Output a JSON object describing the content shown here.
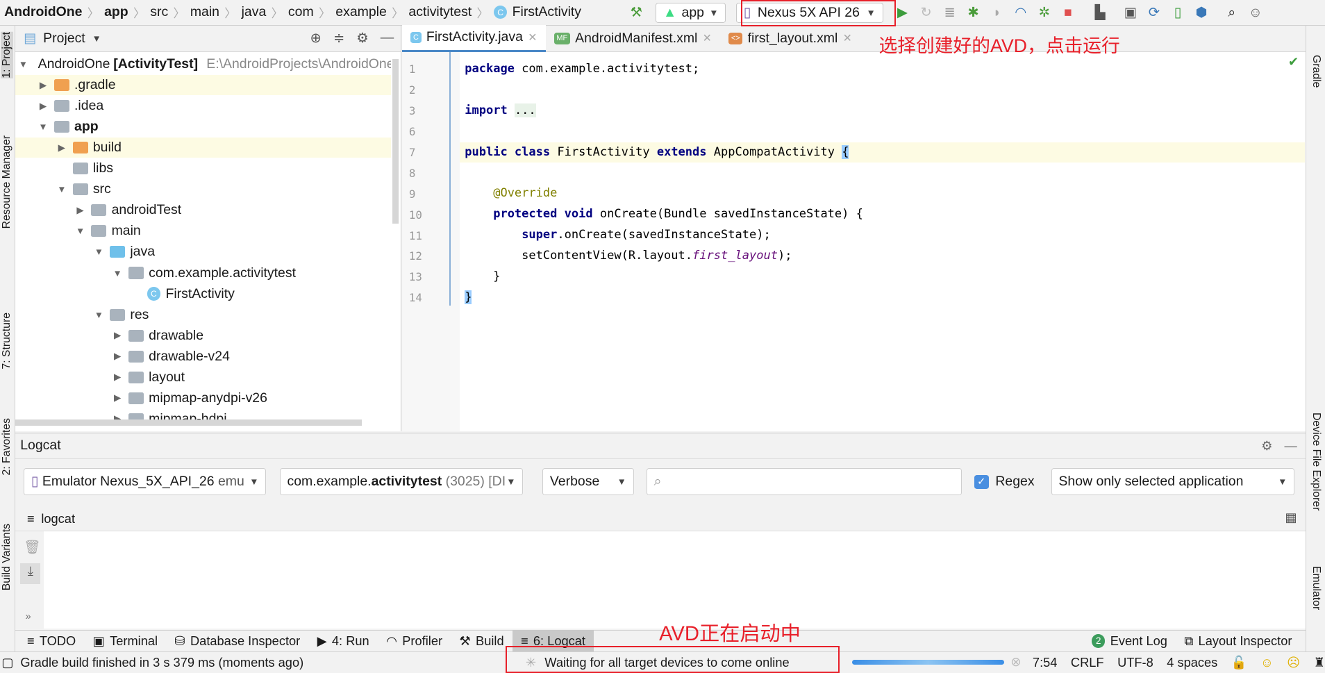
{
  "breadcrumbs": [
    "AndroidOne",
    "app",
    "src",
    "main",
    "java",
    "com",
    "example",
    "activitytest",
    "FirstActivity"
  ],
  "toolbar": {
    "run_config": "app",
    "device": "Nexus 5X API 26",
    "icons": [
      "hammer-icon",
      "run-icon",
      "rerun-icon",
      "apply-changes-icon",
      "debug-icon",
      "attach-icon",
      "profile-icon",
      "debug-attach-icon",
      "stop-icon",
      "sync-icon",
      "terminal-icon",
      "avd-manager-icon",
      "device-icon",
      "sdk-icon",
      "search-icon",
      "account-icon"
    ]
  },
  "left_strip": [
    "1: Project",
    "Resource Manager",
    "7: Structure",
    "2: Favorites",
    "Build Variants"
  ],
  "right_strip": [
    "Gradle",
    "Device File Explorer",
    "Emulator"
  ],
  "project": {
    "title": "Project",
    "tree": [
      {
        "label": "AndroidOne",
        "bold": "[ActivityTest]",
        "path": "E:\\AndroidProjects\\AndroidOne",
        "depth": 0,
        "open": true,
        "hl": false,
        "icon": "gray"
      },
      {
        "label": ".gradle",
        "depth": 1,
        "open": false,
        "hl": true,
        "icon": "orange"
      },
      {
        "label": ".idea",
        "depth": 1,
        "open": false,
        "hl": false,
        "icon": "gray"
      },
      {
        "label": "app",
        "depth": 1,
        "open": true,
        "hl": false,
        "icon": "gray",
        "boldrow": true
      },
      {
        "label": "build",
        "depth": 2,
        "open": false,
        "hl": true,
        "icon": "orange"
      },
      {
        "label": "libs",
        "depth": 2,
        "leaf": true,
        "hl": false,
        "icon": "gray"
      },
      {
        "label": "src",
        "depth": 2,
        "open": true,
        "hl": false,
        "icon": "gray"
      },
      {
        "label": "androidTest",
        "depth": 3,
        "open": false,
        "hl": false,
        "icon": "gray"
      },
      {
        "label": "main",
        "depth": 3,
        "open": true,
        "hl": false,
        "icon": "gray"
      },
      {
        "label": "java",
        "depth": 4,
        "open": true,
        "hl": false,
        "icon": "blue"
      },
      {
        "label": "com.example.activitytest",
        "depth": 5,
        "open": true,
        "hl": false,
        "icon": "gray"
      },
      {
        "label": "FirstActivity",
        "depth": 6,
        "leaf": true,
        "hl": false,
        "icon": "class"
      },
      {
        "label": "res",
        "depth": 4,
        "open": true,
        "hl": false,
        "icon": "gray"
      },
      {
        "label": "drawable",
        "depth": 5,
        "open": false,
        "hl": false,
        "icon": "gray"
      },
      {
        "label": "drawable-v24",
        "depth": 5,
        "open": false,
        "hl": false,
        "icon": "gray"
      },
      {
        "label": "layout",
        "depth": 5,
        "open": false,
        "hl": false,
        "icon": "gray"
      },
      {
        "label": "mipmap-anydpi-v26",
        "depth": 5,
        "open": false,
        "hl": false,
        "icon": "gray"
      },
      {
        "label": "mipmap-hdpi",
        "depth": 5,
        "open": false,
        "hl": false,
        "icon": "gray"
      }
    ]
  },
  "editor": {
    "tabs": [
      {
        "label": "FirstActivity.java",
        "active": true,
        "icon": "C"
      },
      {
        "label": "AndroidManifest.xml",
        "active": false,
        "icon": "MF"
      },
      {
        "label": "first_layout.xml",
        "active": false,
        "icon": "<>"
      }
    ],
    "lines": [
      {
        "n": "1",
        "html": "<span class='kw'>package</span> com.example.activitytest;"
      },
      {
        "n": "2",
        "html": ""
      },
      {
        "n": "3",
        "html": "<span class='kw'>import</span> <span style='background:#e8f2e8'>...</span>"
      },
      {
        "n": "6",
        "html": ""
      },
      {
        "n": "7",
        "html": "<span class='kw'>public class</span> FirstActivity <span class='kw'>extends</span> AppCompatActivity <span style='background:#99ccff'>{</span>"
      },
      {
        "n": "8",
        "html": ""
      },
      {
        "n": "9",
        "html": "    <span class='ann'>@Override</span>"
      },
      {
        "n": "10",
        "html": "    <span class='kw'>protected void</span> onCreate(Bundle savedInstanceState) {"
      },
      {
        "n": "11",
        "html": "        <span class='kw'>super</span>.onCreate(savedInstanceState);"
      },
      {
        "n": "12",
        "html": "        setContentView(R.layout.<span class='it'>first_layout</span>);"
      },
      {
        "n": "13",
        "html": "    }"
      },
      {
        "n": "14",
        "html": "<span style='background:#99ccff'>}</span>"
      }
    ]
  },
  "logcat": {
    "title": "Logcat",
    "device": "Emulator Nexus_5X_API_26",
    "device_suffix": "emu",
    "process_prefix": "com.example.",
    "process_bold": "activitytest",
    "process_pid": "(3025) [DI",
    "level": "Verbose",
    "search_placeholder": "",
    "regex_label": "Regex",
    "regex_checked": true,
    "filter": "Show only selected application",
    "subtab": "logcat"
  },
  "tool_windows": [
    {
      "label": "TODO"
    },
    {
      "label": "Terminal"
    },
    {
      "label": "Database Inspector"
    },
    {
      "label": "4: Run"
    },
    {
      "label": "Profiler"
    },
    {
      "label": "Build"
    },
    {
      "label": "6: Logcat",
      "active": true
    }
  ],
  "tool_windows_right": [
    {
      "label": "Event Log",
      "badge": "2"
    },
    {
      "label": "Layout Inspector"
    }
  ],
  "status": {
    "message": "Gradle build finished in 3 s 379 ms (moments ago)",
    "progress_text": "Waiting for all target devices to come online",
    "position": "7:54",
    "line_sep": "CRLF",
    "encoding": "UTF-8",
    "indent": "4 spaces"
  },
  "annotations": {
    "top": "选择创建好的AVD，点击运行",
    "bottom": "AVD正在启动中"
  },
  "colors": {
    "annotation": "#e8202a",
    "accent": "#4a88c7"
  }
}
